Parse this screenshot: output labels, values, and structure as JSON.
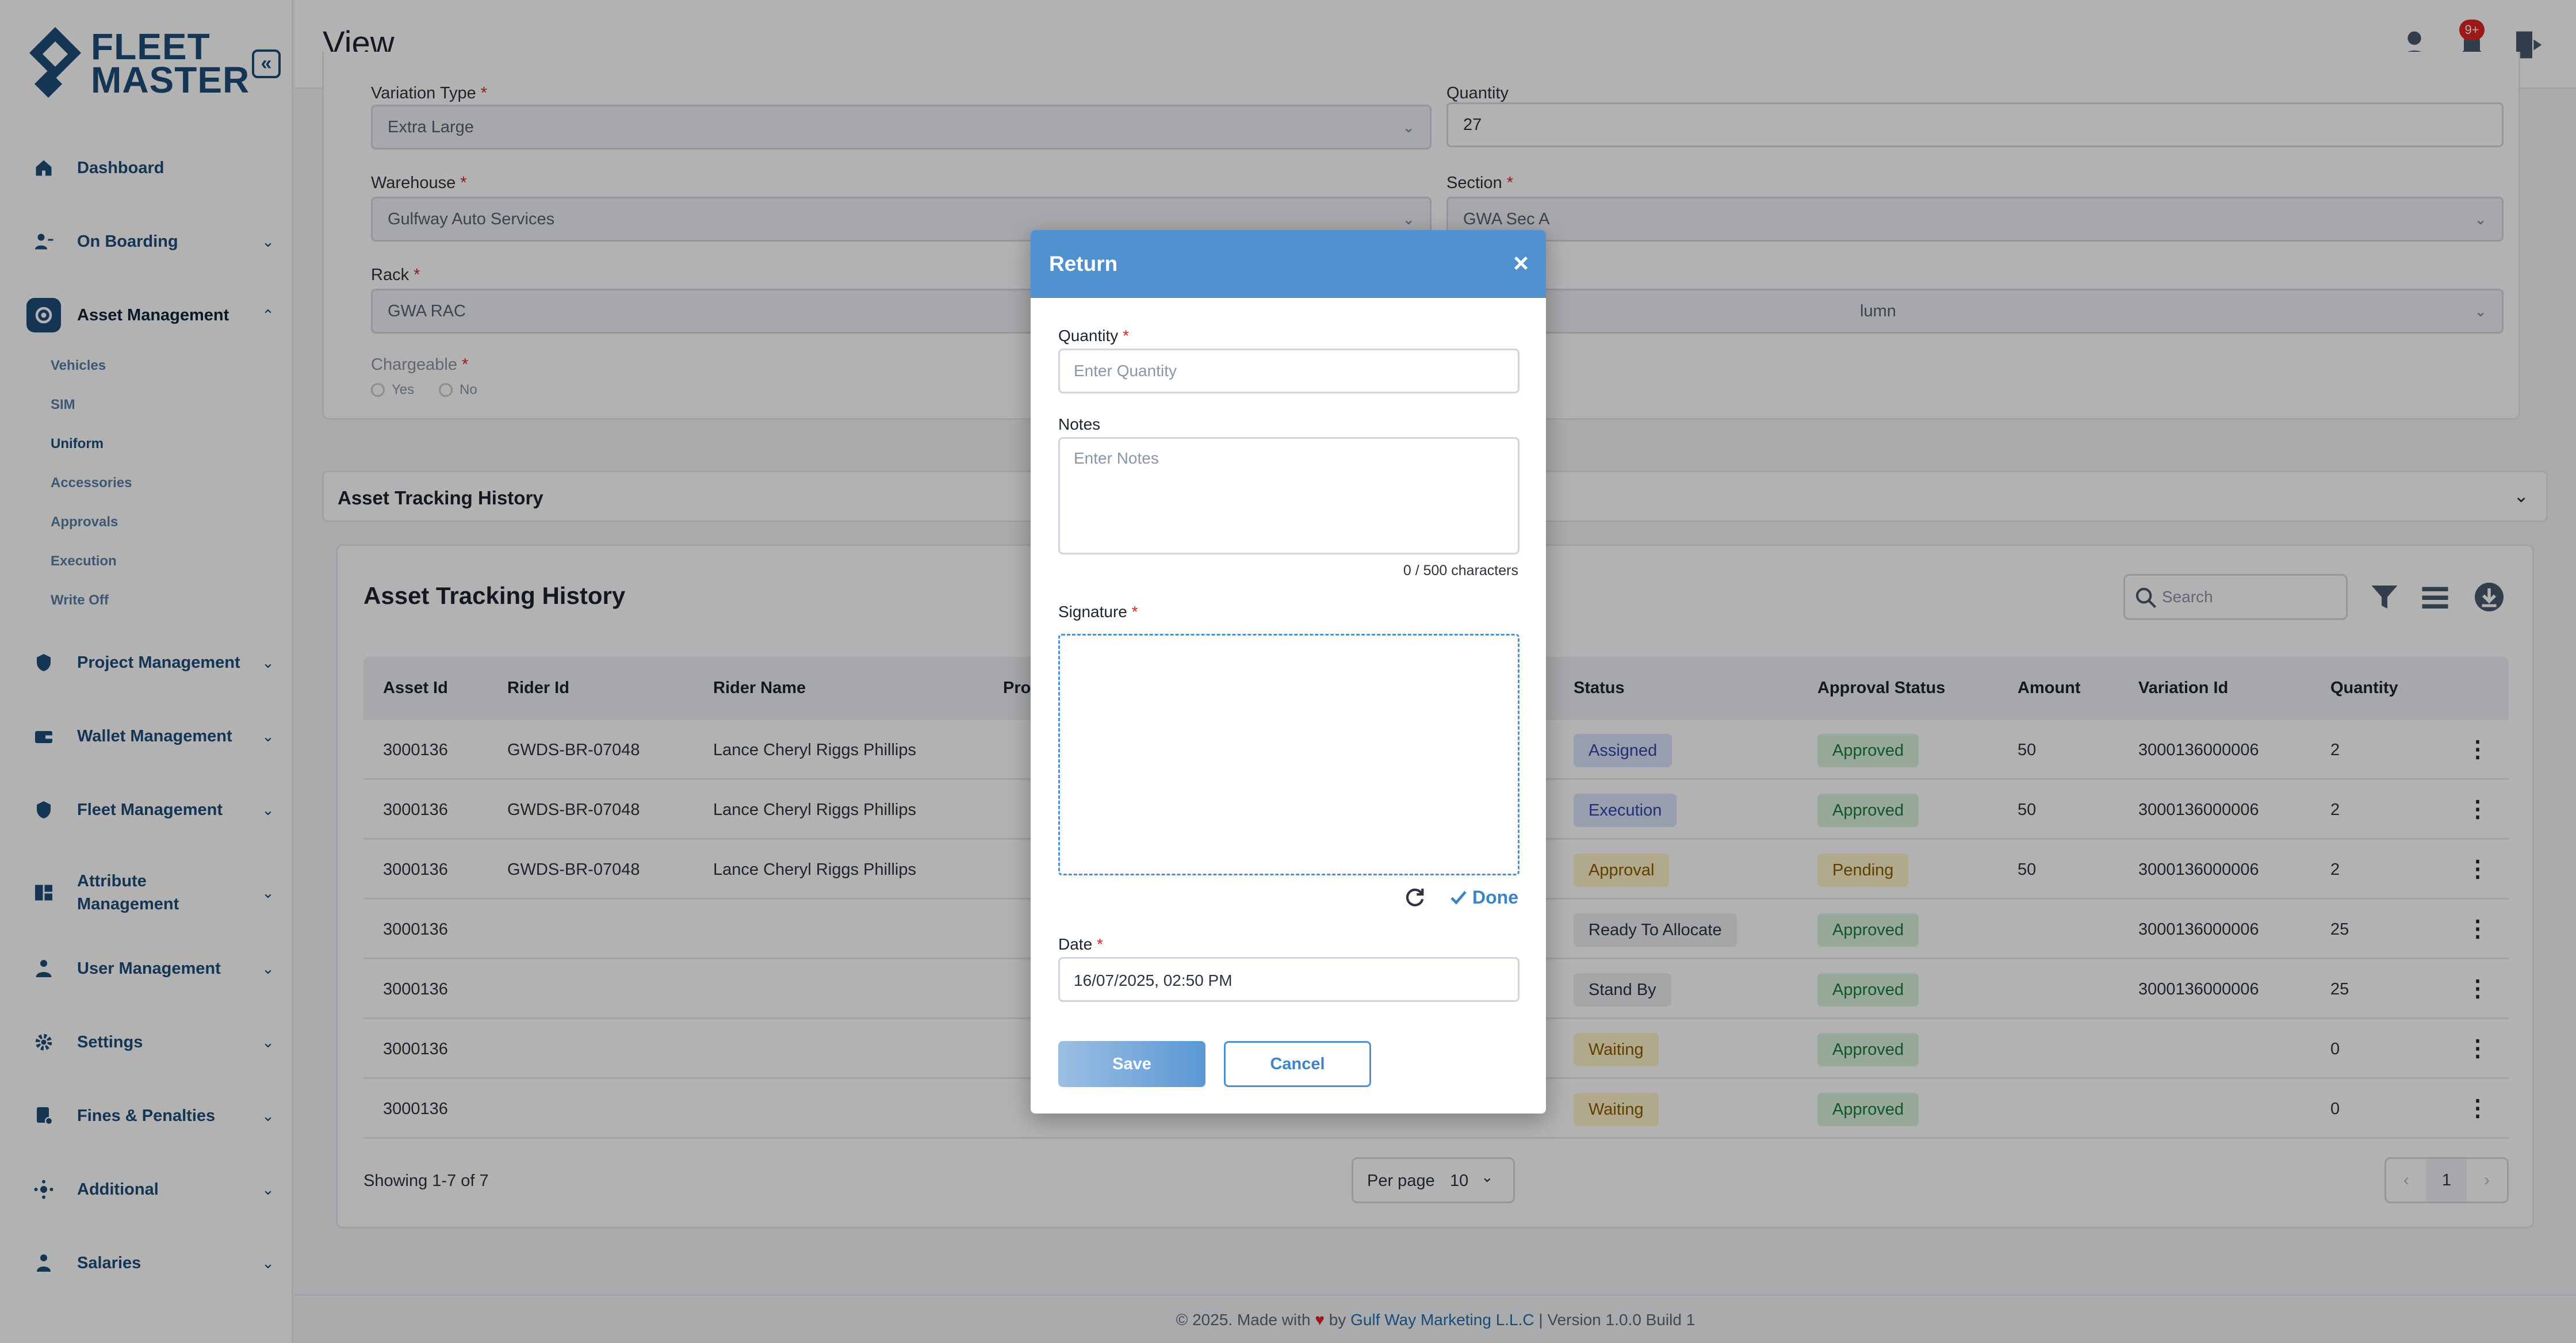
{
  "brand": {
    "line1": "FLEET",
    "line2": "MASTER"
  },
  "sidebar": {
    "collapse_glyph": "«",
    "items": [
      {
        "label": "Dashboard",
        "icon": "home-icon"
      },
      {
        "label": "On Boarding",
        "icon": "user-boarding-icon"
      },
      {
        "label": "Asset Management",
        "icon": "asset-icon"
      },
      {
        "label": "Project Management",
        "icon": "project-icon"
      },
      {
        "label": "Wallet Management",
        "icon": "wallet-icon"
      },
      {
        "label": "Fleet Management",
        "icon": "fleet-icon"
      },
      {
        "label": "Attribute Management",
        "icon": "attribute-icon"
      },
      {
        "label": "User Management",
        "icon": "users-icon"
      },
      {
        "label": "Settings",
        "icon": "gear-icon"
      },
      {
        "label": "Fines & Penalties",
        "icon": "fines-icon"
      },
      {
        "label": "Additional",
        "icon": "additional-icon"
      },
      {
        "label": "Salaries",
        "icon": "salaries-icon"
      }
    ],
    "asset_sub_items": [
      "Vehicles",
      "SIM",
      "Uniform",
      "Accessories",
      "Approvals",
      "Execution",
      "Write Off"
    ]
  },
  "header": {
    "title": "View",
    "notification_badge": "9+"
  },
  "form": {
    "variation_type": {
      "label": "Variation Type",
      "value": "Extra Large"
    },
    "quantity": {
      "label": "Quantity",
      "value": "27"
    },
    "warehouse": {
      "label": "Warehouse",
      "value": "Gulfway Auto Services"
    },
    "section": {
      "label": "Section",
      "value": "GWA Sec A"
    },
    "rack": {
      "label": "Rack",
      "value": "GWA RAC"
    },
    "column": {
      "value": "lumn"
    },
    "chargeable": {
      "label": "Chargeable",
      "yes": "Yes",
      "no": "No"
    }
  },
  "accordion": {
    "title": "Asset Tracking History"
  },
  "history": {
    "title": "Asset Tracking History",
    "search_placeholder": "Search",
    "columns": [
      "Asset Id",
      "Rider Id",
      "Rider Name",
      "Pro",
      "Status",
      "Approval Status",
      "Amount",
      "Variation Id",
      "Quantity"
    ],
    "rows": [
      {
        "asset_id": "3000136",
        "rider_id": "GWDS-BR-07048",
        "rider_name": "Lance Cheryl Riggs Phillips",
        "status": "Assigned",
        "approval": "Approved",
        "amount": "50",
        "variation_id": "3000136000006",
        "quantity": "2"
      },
      {
        "asset_id": "3000136",
        "rider_id": "GWDS-BR-07048",
        "rider_name": "Lance Cheryl Riggs Phillips",
        "status": "Execution",
        "approval": "Approved",
        "amount": "50",
        "variation_id": "3000136000006",
        "quantity": "2"
      },
      {
        "asset_id": "3000136",
        "rider_id": "GWDS-BR-07048",
        "rider_name": "Lance Cheryl Riggs Phillips",
        "status": "Approval",
        "approval": "Pending",
        "amount": "50",
        "variation_id": "3000136000006",
        "quantity": "2"
      },
      {
        "asset_id": "3000136",
        "rider_id": "",
        "rider_name": "",
        "status": "Ready To Allocate",
        "approval": "Approved",
        "amount": "",
        "variation_id": "3000136000006",
        "quantity": "25"
      },
      {
        "asset_id": "3000136",
        "rider_id": "",
        "rider_name": "",
        "status": "Stand By",
        "approval": "Approved",
        "amount": "",
        "variation_id": "3000136000006",
        "quantity": "25"
      },
      {
        "asset_id": "3000136",
        "rider_id": "",
        "rider_name": "",
        "status": "Waiting",
        "approval": "Approved",
        "amount": "",
        "variation_id": "",
        "quantity": "0"
      },
      {
        "asset_id": "3000136",
        "rider_id": "",
        "rider_name": "",
        "status": "Waiting",
        "approval": "Approved",
        "amount": "",
        "variation_id": "",
        "quantity": "0"
      }
    ],
    "showing": "Showing 1-7 of 7",
    "per_page_label": "Per page",
    "per_page_value": "10",
    "current_page": "1"
  },
  "modal": {
    "title": "Return",
    "close_glyph": "×",
    "quantity_label": "Quantity",
    "quantity_placeholder": "Enter Quantity",
    "notes_label": "Notes",
    "notes_placeholder": "Enter Notes",
    "char_count": "0 / 500 characters",
    "signature_label": "Signature",
    "done_label": "Done",
    "date_label": "Date",
    "date_value": "16/07/2025, 02:50 PM",
    "save_label": "Save",
    "cancel_label": "Cancel"
  },
  "footer": {
    "prefix": "© 2025. Made with",
    "by": "by",
    "company": "Gulf Way Marketing L.L.C",
    "suffix": "| Version 1.0.0 Build 1"
  },
  "colors": {
    "brand": "#1f4d7a",
    "modal_header": "#4f90cf",
    "status_blue_bg": "#dce3fb",
    "status_yellow_bg": "#fdf3c8",
    "status_grey_bg": "#eceef1",
    "approved_bg": "#d8f2de",
    "pending_bg": "#fdf3c8"
  }
}
